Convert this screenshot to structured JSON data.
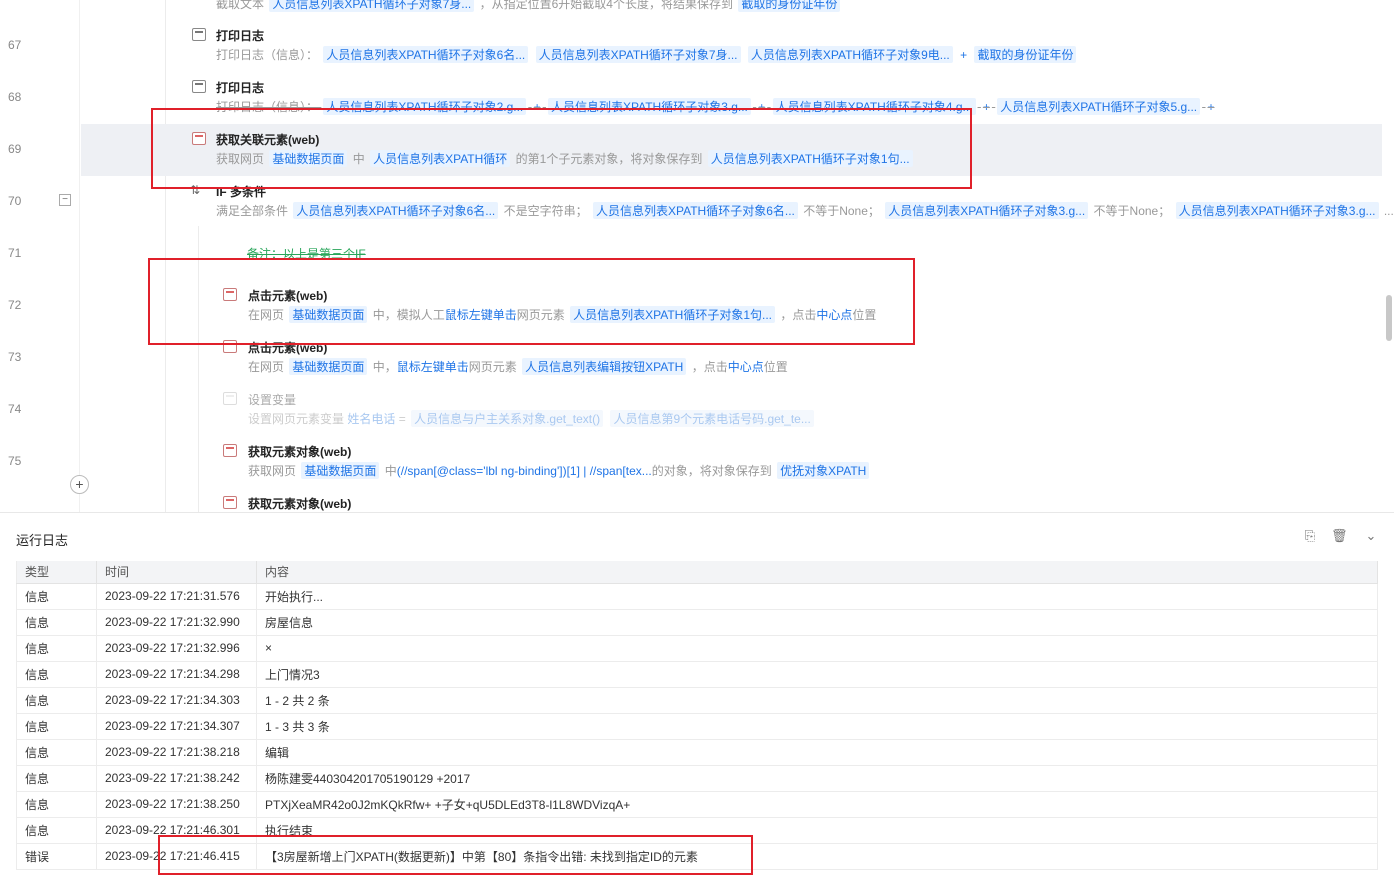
{
  "editor": {
    "top_partial_desc": {
      "prefix": "截取文本",
      "tag1": "人员信息列表XPATH循环子对象7身...",
      "mid": "，从指定位置6开始截取4个长度，将结果保存到",
      "tag2": "截取的身份证年份"
    },
    "lines": [
      {
        "no": "67",
        "title": "打印日志",
        "desc_prefix": "打印日志（信息）：",
        "tags": [
          "人员信息列表XPATH循环子对象6名...",
          "人员信息列表XPATH循环子对象7身...",
          "人员信息列表XPATH循环子对象9电...",
          "截取的身份证年份"
        ],
        "plus": "+"
      },
      {
        "no": "68",
        "title": "打印日志",
        "desc_prefix": "打印日志（信息）：",
        "tags": [
          "人员信息列表XPATH循环子对象2.g...",
          "人员信息列表XPATH循环子对象3.g...",
          "人员信息列表XPATH循环子对象4.g...",
          "人员信息列表XPATH循环子对象5.g..."
        ],
        "plus": "+"
      },
      {
        "no": "69",
        "title": "获取关联元素(web)",
        "d1": "获取网页",
        "t1": "基础数据页面",
        "d2": "中",
        "t2": "人员信息列表XPATH循环",
        "d3": "的第1个子元素对象，将对象保存到",
        "t3": "人员信息列表XPATH循环子对象1句..."
      },
      {
        "no": "70",
        "title": "IF 多条件",
        "d1": "满足全部条件",
        "t1": "人员信息列表XPATH循环子对象6名...",
        "d2": "不是空字符串；",
        "t2": "人员信息列表XPATH循环子对象6名...",
        "d3": "不等于None；",
        "t3": "人员信息列表XPATH循环子对象3.g...",
        "d4": "不等于None；",
        "t4": "人员信息列表XPATH循环子对象3.g...",
        "d5": "..."
      },
      {
        "no": "71",
        "note": "备注：以上是第三个IF"
      },
      {
        "no": "72",
        "title": "点击元素(web)",
        "d1": "在网页",
        "t1": "基础数据页面",
        "d2": "中，模拟人工",
        "k1": "鼠标左键单击",
        "d3": "网页元素",
        "t2": "人员信息列表XPATH循环子对象1句...",
        "d4": "，点击",
        "k2": "中心点",
        "d5": "位置"
      },
      {
        "no": "73",
        "title": "点击元素(web)",
        "d1": "在网页",
        "t1": "基础数据页面",
        "d2": "中，",
        "k1": "鼠标左键单击",
        "d3": "网页元素",
        "t2": "人员信息列表编辑按钮XPATH",
        "d4": "，点击",
        "k2": "中心点",
        "d5": "位置"
      },
      {
        "no": "74",
        "title": "设置变量",
        "d1": "设置网页元素变量",
        "k1": "姓名电话",
        "op": "=",
        "t1": "人员信息与户主关系对象.get_text()",
        "t2": "人员信息第9个元素电话号码.get_te..."
      },
      {
        "no": "75",
        "title": "获取元素对象(web)",
        "d1": "获取网页",
        "t1": "基础数据页面",
        "d2": "中",
        "k1": "(//span[@class='lbl ng-binding'])[1] |  //span[tex...",
        "d3": "的对象，将对象保存到",
        "t2": "优抚对象XPATH"
      },
      {
        "no": "",
        "title": "获取元素对象(web)"
      }
    ],
    "add_button": "+"
  },
  "log": {
    "title": "运行日志",
    "columns": [
      "类型",
      "时间",
      "内容"
    ],
    "rows": [
      {
        "type": "信息",
        "time": "2023-09-22 17:21:31.576",
        "content": "开始执行..."
      },
      {
        "type": "信息",
        "time": "2023-09-22 17:21:32.990",
        "content": "房屋信息"
      },
      {
        "type": "信息",
        "time": "2023-09-22 17:21:32.996",
        "content": "×"
      },
      {
        "type": "信息",
        "time": "2023-09-22 17:21:34.298",
        "content": "上门情况3"
      },
      {
        "type": "信息",
        "time": "2023-09-22 17:21:34.303",
        "content": "1 - 2   共 2 条"
      },
      {
        "type": "信息",
        "time": "2023-09-22 17:21:34.307",
        "content": "1 - 3   共 3 条"
      },
      {
        "type": "信息",
        "time": "2023-09-22 17:21:38.218",
        "content": " 编辑"
      },
      {
        "type": "信息",
        "time": "2023-09-22 17:21:38.242",
        "content": "杨陈建雯440304201705190129 +2017"
      },
      {
        "type": "信息",
        "time": "2023-09-22 17:21:38.250",
        "content": "PTXjXeaMR42o0J2mKQkRfw+   +子女+qU5DLEd3T8-l1L8WDVizqA+"
      },
      {
        "type": "信息",
        "time": "2023-09-22 17:21:46.301",
        "content": "执行结束"
      },
      {
        "type": "错误",
        "time": "2023-09-22 17:21:46.415",
        "content": "【3房屋新增上门XPATH(数据更新)】中第【80】条指令出错: 未找到指定ID的元素"
      }
    ]
  }
}
